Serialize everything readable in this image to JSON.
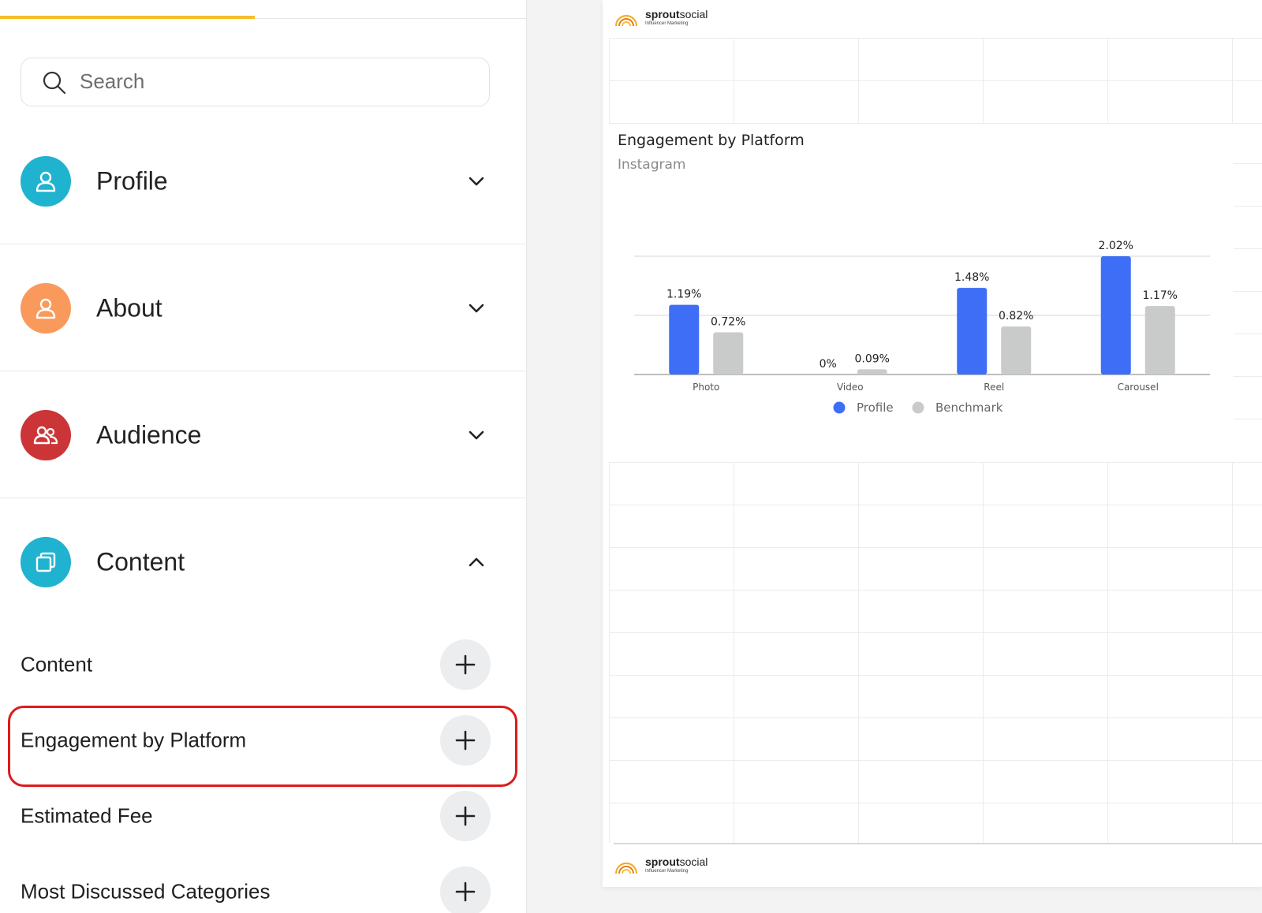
{
  "search": {
    "placeholder": "Search"
  },
  "sections": [
    {
      "title": "Profile",
      "icon": "user-icon",
      "color": "#1fb3cf",
      "expanded": false
    },
    {
      "title": "About",
      "icon": "user-icon",
      "color": "#f99a5c",
      "expanded": false
    },
    {
      "title": "Audience",
      "icon": "group-icon",
      "color": "#cc3537",
      "expanded": false
    },
    {
      "title": "Content",
      "icon": "copy-icon",
      "color": "#1fb3cf",
      "expanded": true
    }
  ],
  "content_items": [
    {
      "label": "Content"
    },
    {
      "label": "Engagement by Platform",
      "highlighted": true
    },
    {
      "label": "Estimated Fee"
    },
    {
      "label": "Most Discussed Categories"
    }
  ],
  "report": {
    "brand_name_bold": "sprout",
    "brand_name_rest": "social",
    "brand_sub": "Influencer Marketing"
  },
  "colors": {
    "profile": "#3d6ef5",
    "benchmark": "#c9cbcb",
    "accent": "#f4bd2a",
    "highlight": "#dd1b1b"
  },
  "chart_data": {
    "type": "bar",
    "title": "Engagement by Platform",
    "subtitle": "Instagram",
    "categories": [
      "Photo",
      "Video",
      "Reel",
      "Carousel"
    ],
    "series": [
      {
        "name": "Profile",
        "values": [
          1.19,
          0,
          1.48,
          2.02
        ],
        "labels": [
          "1.19%",
          "0%",
          "1.48%",
          "2.02%"
        ]
      },
      {
        "name": "Benchmark",
        "values": [
          0.72,
          0.09,
          0.82,
          1.17
        ],
        "labels": [
          "0.72%",
          "0.09%",
          "0.82%",
          "1.17%"
        ]
      }
    ],
    "ylim": [
      0,
      2.02
    ],
    "grid": true,
    "legend": "bottom-center"
  }
}
